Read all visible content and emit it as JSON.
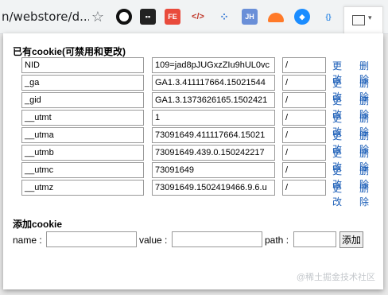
{
  "browser": {
    "url_text": "n/webstore/d...",
    "star_glyph": "☆",
    "extensions": [
      {
        "name": "obs-like-extension",
        "label": ""
      },
      {
        "name": "bitdefender-extension",
        "label": "▪▪"
      },
      {
        "name": "fe-helper-extension",
        "label": "FE"
      },
      {
        "name": "code-extension",
        "label": "</>"
      },
      {
        "name": "molecule-extension",
        "label": "⁘"
      },
      {
        "name": "jh-extension",
        "label": "JH"
      },
      {
        "name": "cloud-extension",
        "label": ""
      },
      {
        "name": "diamond-extension",
        "label": "◆"
      },
      {
        "name": "json-extension",
        "label": "{}"
      }
    ]
  },
  "existing": {
    "title": "已有cookie(可禁用和更改)",
    "disable_label": "更改",
    "delete_label": "删除",
    "rows": [
      {
        "name": "NID",
        "value": "109=jad8pJUGxzZIu9hUL0vc",
        "path": "/"
      },
      {
        "name": "_ga",
        "value": "GA1.3.411117664.15021544",
        "path": "/"
      },
      {
        "name": "_gid",
        "value": "GA1.3.1373626165.1502421",
        "path": "/"
      },
      {
        "name": "__utmt",
        "value": "1",
        "path": "/"
      },
      {
        "name": "__utma",
        "value": "73091649.411117664.15021",
        "path": "/"
      },
      {
        "name": "__utmb",
        "value": "73091649.439.0.150242217",
        "path": "/"
      },
      {
        "name": "__utmc",
        "value": "73091649",
        "path": "/"
      },
      {
        "name": "__utmz",
        "value": "73091649.1502419466.9.6.u",
        "path": "/"
      }
    ]
  },
  "add": {
    "title": "添加cookie",
    "name_label": "name :",
    "value_label": "value :",
    "path_label": "path :",
    "button_label": "添加"
  },
  "watermark": "@稀土掘金技术社区"
}
